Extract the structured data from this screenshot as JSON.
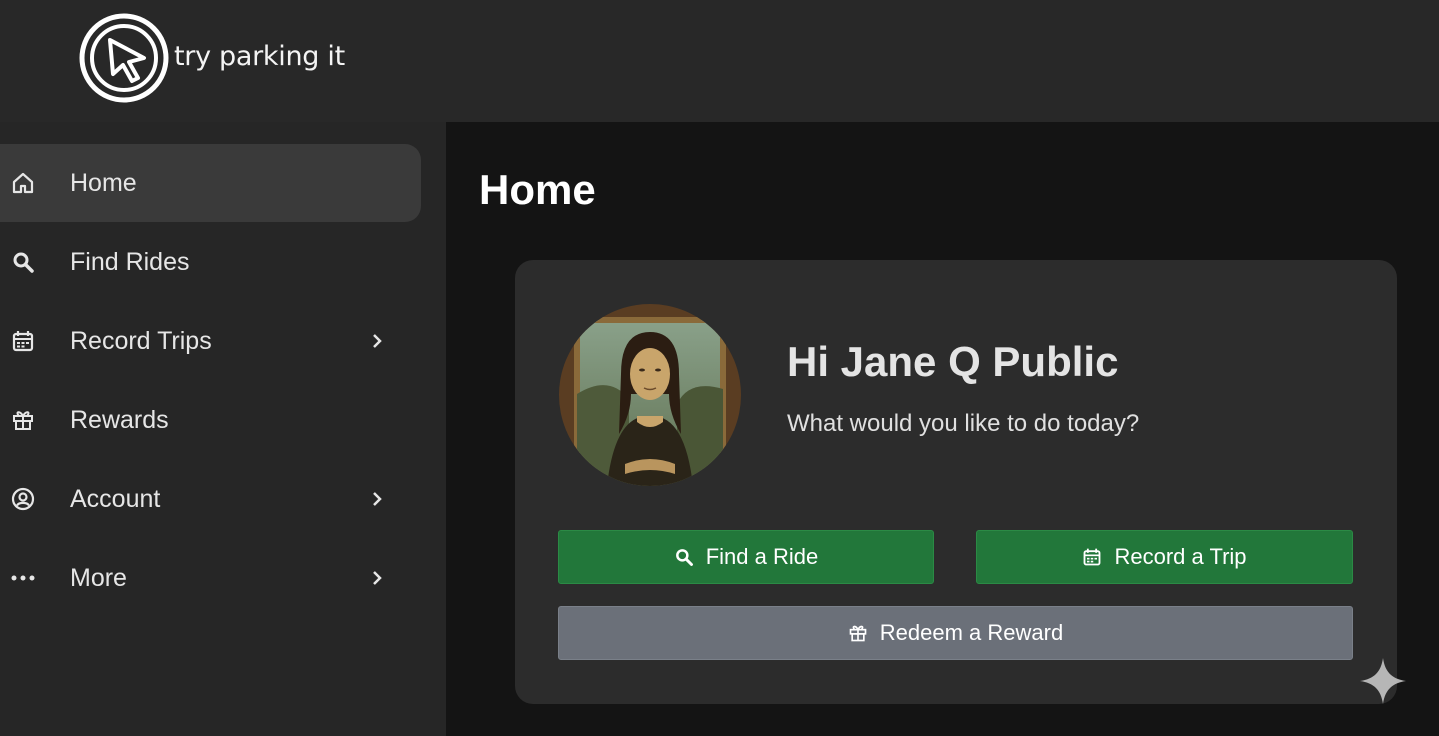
{
  "app": {
    "logo_text": "try parking it"
  },
  "sidebar": {
    "items": [
      {
        "label": "Home",
        "icon": "home-icon",
        "active": true,
        "has_submenu": false
      },
      {
        "label": "Find Rides",
        "icon": "search-icon",
        "active": false,
        "has_submenu": false
      },
      {
        "label": "Record Trips",
        "icon": "calendar-icon",
        "active": false,
        "has_submenu": true
      },
      {
        "label": "Rewards",
        "icon": "gift-icon",
        "active": false,
        "has_submenu": false
      },
      {
        "label": "Account",
        "icon": "user-circle-icon",
        "active": false,
        "has_submenu": true
      },
      {
        "label": "More",
        "icon": "more-dots-icon",
        "active": false,
        "has_submenu": true
      }
    ]
  },
  "main": {
    "title": "Home",
    "card": {
      "avatar": "mona-lisa-portrait",
      "greeting": "Hi Jane Q Public",
      "subtext": "What would you like to do today?",
      "buttons": {
        "find_ride": {
          "label": "Find a Ride",
          "icon": "search-icon"
        },
        "record_trip": {
          "label": "Record a Trip",
          "icon": "calendar-icon"
        },
        "redeem_reward": {
          "label": "Redeem a Reward",
          "icon": "gift-icon"
        }
      }
    }
  },
  "colors": {
    "primary_button": "#22773a",
    "secondary_button": "#6b7079",
    "sidebar_active": "#3a3a3a",
    "main_background": "#141414",
    "card_background": "#2c2c2c"
  }
}
